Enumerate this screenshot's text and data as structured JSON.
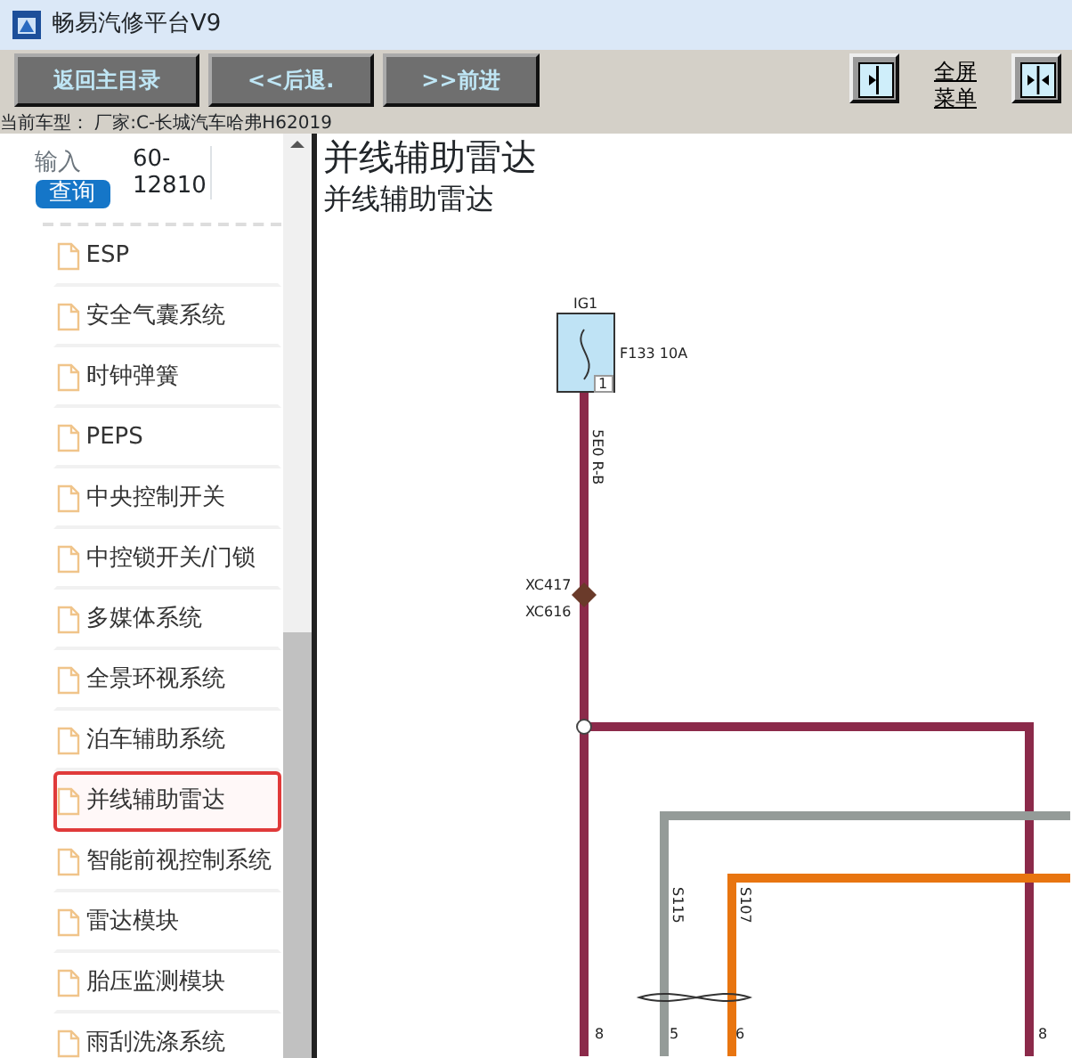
{
  "window": {
    "title": "畅易汽修平台V9"
  },
  "toolbar": {
    "buttons": [
      {
        "label": "返回主目录"
      },
      {
        "label": "<<后退."
      },
      {
        "label": ">>前进"
      }
    ],
    "fullscreen_menu": [
      "全屏",
      "菜单"
    ]
  },
  "car_model": "当前车型： 厂家:C-长城汽车哈弗H62019",
  "sidebar": {
    "search": {
      "label": "输入",
      "value": "60-12810",
      "button": "查询"
    },
    "items": [
      {
        "label": "ESP",
        "selected": false
      },
      {
        "label": "安全气囊系统",
        "selected": false
      },
      {
        "label": "时钟弹簧",
        "selected": false
      },
      {
        "label": "PEPS",
        "selected": false
      },
      {
        "label": "中央控制开关",
        "selected": false
      },
      {
        "label": "中控锁开关/门锁",
        "selected": false
      },
      {
        "label": "多媒体系统",
        "selected": false
      },
      {
        "label": "全景环视系统",
        "selected": false
      },
      {
        "label": "泊车辅助系统",
        "selected": false
      },
      {
        "label": "并线辅助雷达",
        "selected": true
      },
      {
        "label": "智能前视控制系统",
        "selected": false
      },
      {
        "label": "雷达模块",
        "selected": false
      },
      {
        "label": "胎压监测模块",
        "selected": false
      },
      {
        "label": "雨刮洗涤系统",
        "selected": false
      }
    ]
  },
  "content": {
    "title": "并线辅助雷达",
    "subtitle": "并线辅助雷达",
    "diagram": {
      "fuse_label": "IG1",
      "fuse_rating": "F133 10A",
      "fuse_pin": "1",
      "wire_label": "5E0 R-B",
      "connectors": [
        "XC417",
        "XC616"
      ],
      "wire_codes": [
        "S115",
        "S107"
      ],
      "pins": [
        "8",
        "5",
        "6",
        "8"
      ]
    }
  }
}
